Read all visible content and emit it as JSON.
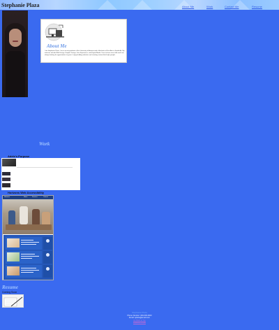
{
  "header": {
    "site_title": "Stephanie Plaza",
    "nav": [
      {
        "label": "About Me"
      },
      {
        "label": "Work"
      },
      {
        "label": "Contact Me"
      },
      {
        "label": "Resume"
      }
    ]
  },
  "about": {
    "title": "About Me",
    "text": "I am Stephanie Plaza. I am a recent graduate of the University of Arizona with a Bachelor of Fine Arts in Studio Art. My interests include Web Design, Graphic Design, User Experience, and Digital Media. I love to learn new skills and I am always looking for opportunities to grow. I enjoy building websites and creating content that helps people."
  },
  "work": {
    "heading": "Work",
    "projects": [
      {
        "title": "Adele's Purpose"
      },
      {
        "title": "Horizons Web Accessibility",
        "preview_nav": [
          "Horizons",
          "Home",
          "Services",
          "Contact"
        ]
      }
    ]
  },
  "resume": {
    "heading": "Resume",
    "status": "Coming Soon"
  },
  "footer": {
    "line1": "Stephanie Plaza",
    "line2": "Phone Number: 000-000-0000",
    "line3": "Email: splaza@email.com",
    "line4": "Go Back to Top",
    "line5": "LinkedIn Profile"
  },
  "colors": {
    "background": "#3a6af0",
    "accent_heading": "#9fc3ff",
    "nav_link": "#2c57e8"
  }
}
